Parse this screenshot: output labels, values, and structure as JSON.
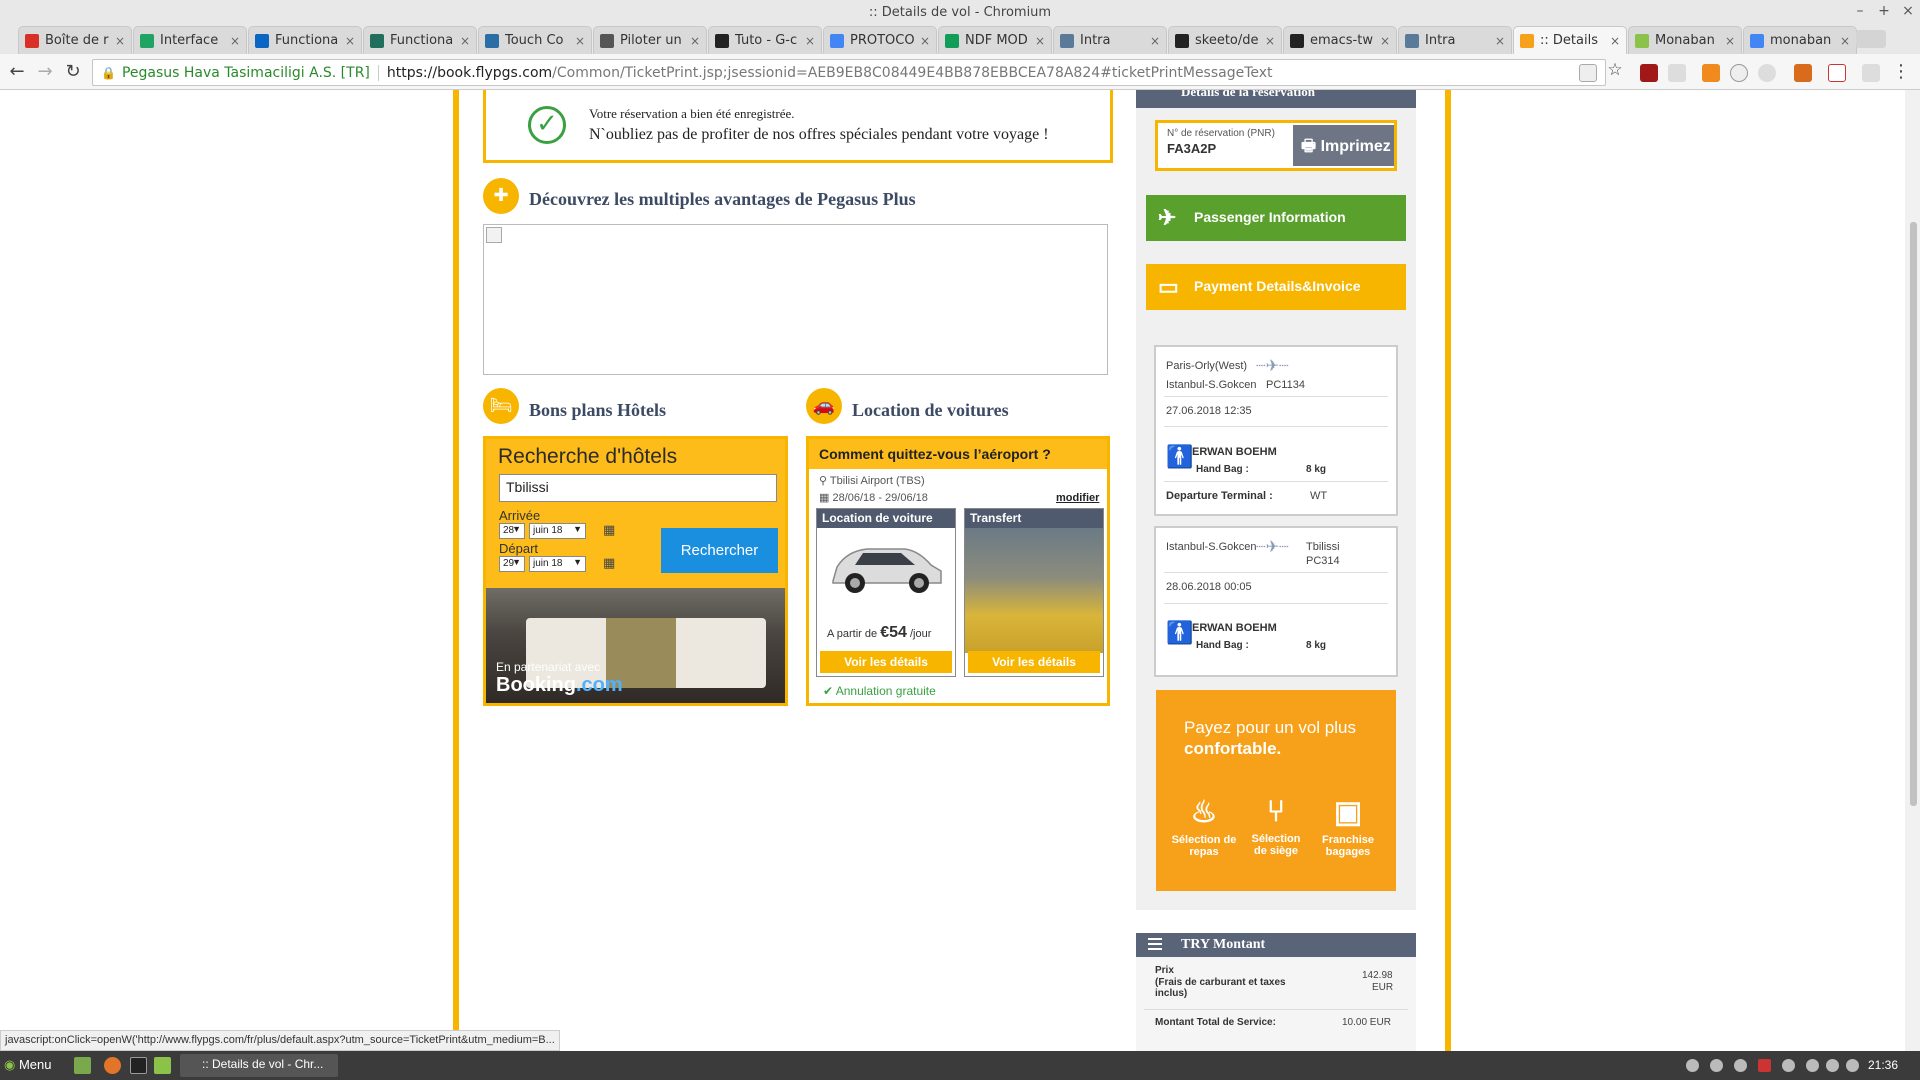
{
  "window": {
    "title": ":: Details de vol - Chromium",
    "min": "–",
    "max": "+",
    "close": "×"
  },
  "tabs": [
    {
      "label": "Boîte de r",
      "color": "#d93025"
    },
    {
      "label": "Interface",
      "color": "#1fa463"
    },
    {
      "label": "Functiona",
      "color": "#0a66c2"
    },
    {
      "label": "Functiona",
      "color": "#1f6f5c"
    },
    {
      "label": "Touch Co",
      "color": "#2b6ea6"
    },
    {
      "label": "Piloter un",
      "color": "#555555"
    },
    {
      "label": "Tuto - G-c",
      "color": "#222222"
    },
    {
      "label": "PROTOCO",
      "color": "#4285f4"
    },
    {
      "label": "NDF MOD",
      "color": "#0f9d58"
    },
    {
      "label": "Intra",
      "color": "#5a7a99"
    },
    {
      "label": "skeeto/de",
      "color": "#222222"
    },
    {
      "label": "emacs-tw",
      "color": "#222222"
    },
    {
      "label": "Intra",
      "color": "#5a7a99"
    },
    {
      "label": ":: Details",
      "color": "#f7a11a"
    },
    {
      "label": "Monaban",
      "color": "#8bc34a"
    },
    {
      "label": "monaban",
      "color": "#4285f4"
    }
  ],
  "toolbar": {
    "org": "Pegasus Hava Tasimaciligi A.S. [TR]",
    "url_host": "https://book.flypgs.com",
    "url_path": "/Common/TicketPrint.jsp;jsessionid=AEB9EB8C08449E4BB878EBBCEA78A824#ticketPrintMessageText"
  },
  "confirm": {
    "line1": "Votre réservation a bien été enregistrée.",
    "line2": "N`oubliez pas de profiter de nos offres spéciales pendant votre voyage !"
  },
  "pegasus_plus": {
    "title": "Découvrez les multiples avantages de Pegasus Plus"
  },
  "hotels": {
    "title": "Bons plans Hôtels",
    "search_title": "Recherche d'hôtels",
    "city": "Tbilissi",
    "arrival_label": "Arrivée",
    "departure_label": "Départ",
    "arrival_day": "28",
    "arrival_month": "juin 18",
    "departure_day": "29",
    "departure_month": "juin 18",
    "search_button": "Rechercher",
    "partner_text": "En partenariat avec",
    "partner_brand": "Booking",
    "partner_tld": ".com"
  },
  "cars": {
    "title": "Location de voitures",
    "question": "Comment quittez-vous l’aéroport ?",
    "airport": "Tbilisi Airport (TBS)",
    "dates": "28/06/18 - 29/06/18",
    "modify": "modifier",
    "rental_title": "Location de voiture",
    "price_prefix": "A partir de",
    "price": "€54",
    "price_suffix": "/jour",
    "details_button": "Voir les détails",
    "transfer_title": "Transfert",
    "transfer_button": "Voir les détails",
    "free_cancel": "Annulation gratuite"
  },
  "sidebar": {
    "header": "Détails de la réservation",
    "pnr_label": "N° de réservation (PNR)",
    "pnr": "FA3A2P",
    "print_button": "Imprimez",
    "passenger_button": "Passenger Information",
    "payment_button": "Payment Details&Invoice",
    "flights": [
      {
        "from": "Paris-Orly(West)",
        "to": "Istanbul-S.Gokcen",
        "flight": "PC1134",
        "datetime": "27.06.2018 12:35",
        "passenger": "ERWAN BOEHM",
        "bag_label": "Hand Bag :",
        "bag_value": "8 kg",
        "terminal_label": "Departure Terminal :",
        "terminal_value": "WT"
      },
      {
        "from": "Istanbul-S.Gokcen",
        "to": "Tbilissi",
        "flight": "PC314",
        "datetime": "28.06.2018 00:05",
        "passenger": "ERWAN BOEHM",
        "bag_label": "Hand Bag :",
        "bag_value": "8 kg"
      }
    ],
    "promo": {
      "line1": "Payez pour un vol plus",
      "line2": "confortable.",
      "items": [
        {
          "line1": "Sélection de",
          "line2": "repas"
        },
        {
          "line1": "Sélection",
          "line2": "de siège"
        },
        {
          "line1": "Franchise",
          "line2": "bagages"
        }
      ]
    },
    "amount": {
      "header": "TRY Montant",
      "price_label": "Prix",
      "price_note": "(Frais de carburant et taxes inclus)",
      "price_value": "142.98",
      "price_currency": "EUR",
      "service_label": "Montant Total de Service:",
      "service_value": "10.00 EUR"
    }
  },
  "status_url": "javascript:onClick=openW('http://www.flypgs.com/fr/plus/default.aspx?utm_source=TicketPrint&utm_medium=B...",
  "taskbar": {
    "menu": "Menu",
    "window": ":: Details de vol - Chr...",
    "time": "21:36"
  }
}
